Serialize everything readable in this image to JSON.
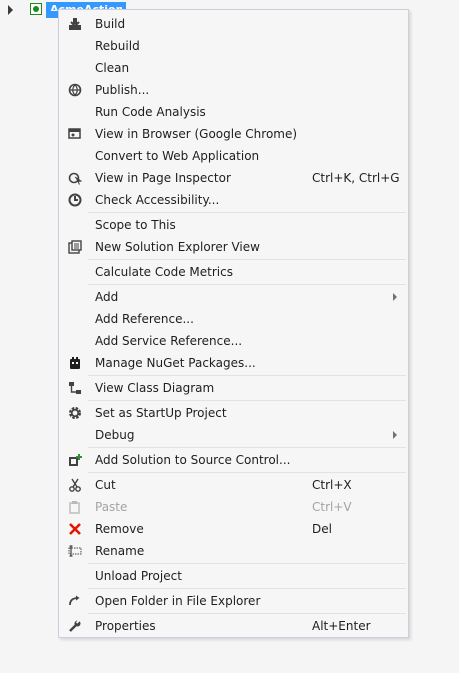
{
  "tree": {
    "project_label": "AcmeActions"
  },
  "menu": {
    "items": [
      {
        "id": "build",
        "label": "Build",
        "shortcut": "",
        "submenu": false,
        "disabled": false,
        "icon": "build-icon"
      },
      {
        "id": "rebuild",
        "label": "Rebuild",
        "shortcut": "",
        "submenu": false,
        "disabled": false,
        "icon": ""
      },
      {
        "id": "clean",
        "label": "Clean",
        "shortcut": "",
        "submenu": false,
        "disabled": false,
        "icon": ""
      },
      {
        "id": "publish",
        "label": "Publish...",
        "shortcut": "",
        "submenu": false,
        "disabled": false,
        "icon": "publish-globe-icon"
      },
      {
        "id": "run-code-analysis",
        "label": "Run Code Analysis",
        "shortcut": "",
        "submenu": false,
        "disabled": false,
        "icon": ""
      },
      {
        "id": "view-in-browser",
        "label": "View in Browser (Google Chrome)",
        "shortcut": "",
        "submenu": false,
        "disabled": false,
        "icon": "browser-icon"
      },
      {
        "id": "convert-to-web-application",
        "label": "Convert to Web Application",
        "shortcut": "",
        "submenu": false,
        "disabled": false,
        "icon": ""
      },
      {
        "id": "view-in-page-inspector",
        "label": "View in Page Inspector",
        "shortcut": "Ctrl+K, Ctrl+G",
        "submenu": false,
        "disabled": false,
        "icon": "page-inspector-icon"
      },
      {
        "id": "check-accessibility",
        "label": "Check Accessibility...",
        "shortcut": "",
        "submenu": false,
        "disabled": false,
        "icon": "accessibility-icon"
      },
      {
        "id": "scope-to-this",
        "label": "Scope to This",
        "shortcut": "",
        "submenu": false,
        "disabled": false,
        "icon": ""
      },
      {
        "id": "new-solution-explorer-view",
        "label": "New Solution Explorer View",
        "shortcut": "",
        "submenu": false,
        "disabled": false,
        "icon": "solution-explorer-icon"
      },
      {
        "id": "calculate-code-metrics",
        "label": "Calculate Code Metrics",
        "shortcut": "",
        "submenu": false,
        "disabled": false,
        "icon": ""
      },
      {
        "id": "add",
        "label": "Add",
        "shortcut": "",
        "submenu": true,
        "disabled": false,
        "icon": ""
      },
      {
        "id": "add-reference",
        "label": "Add Reference...",
        "shortcut": "",
        "submenu": false,
        "disabled": false,
        "icon": ""
      },
      {
        "id": "add-service-reference",
        "label": "Add Service Reference...",
        "shortcut": "",
        "submenu": false,
        "disabled": false,
        "icon": ""
      },
      {
        "id": "manage-nuget-packages",
        "label": "Manage NuGet Packages...",
        "shortcut": "",
        "submenu": false,
        "disabled": false,
        "icon": "nuget-icon"
      },
      {
        "id": "view-class-diagram",
        "label": "View Class Diagram",
        "shortcut": "",
        "submenu": false,
        "disabled": false,
        "icon": "class-diagram-icon"
      },
      {
        "id": "set-as-startup-project",
        "label": "Set as StartUp Project",
        "shortcut": "",
        "submenu": false,
        "disabled": false,
        "icon": "gear-icon"
      },
      {
        "id": "debug",
        "label": "Debug",
        "shortcut": "",
        "submenu": true,
        "disabled": false,
        "icon": ""
      },
      {
        "id": "add-solution-to-source-control",
        "label": "Add Solution to Source Control...",
        "shortcut": "",
        "submenu": false,
        "disabled": false,
        "icon": "source-control-add-icon"
      },
      {
        "id": "cut",
        "label": "Cut",
        "shortcut": "Ctrl+X",
        "submenu": false,
        "disabled": false,
        "icon": "scissors-icon"
      },
      {
        "id": "paste",
        "label": "Paste",
        "shortcut": "Ctrl+V",
        "submenu": false,
        "disabled": true,
        "icon": "paste-icon"
      },
      {
        "id": "remove",
        "label": "Remove",
        "shortcut": "Del",
        "submenu": false,
        "disabled": false,
        "icon": "remove-x-icon"
      },
      {
        "id": "rename",
        "label": "Rename",
        "shortcut": "",
        "submenu": false,
        "disabled": false,
        "icon": "rename-icon"
      },
      {
        "id": "unload-project",
        "label": "Unload Project",
        "shortcut": "",
        "submenu": false,
        "disabled": false,
        "icon": ""
      },
      {
        "id": "open-folder-in-file-explorer",
        "label": "Open Folder in File Explorer",
        "shortcut": "",
        "submenu": false,
        "disabled": false,
        "icon": "open-folder-arrow-icon"
      },
      {
        "id": "properties",
        "label": "Properties",
        "shortcut": "Alt+Enter",
        "submenu": false,
        "disabled": false,
        "icon": "wrench-icon"
      }
    ]
  },
  "colors": {
    "selection": "#3399ff",
    "menu_background": "#f6f6f6",
    "menu_border": "#cccedb",
    "separator": "#e0e3e6",
    "disabled_text": "#a2a4a5",
    "remove_icon": "#e51400",
    "nuget_icon": "#004880",
    "source_control_icon": "#388a34"
  }
}
